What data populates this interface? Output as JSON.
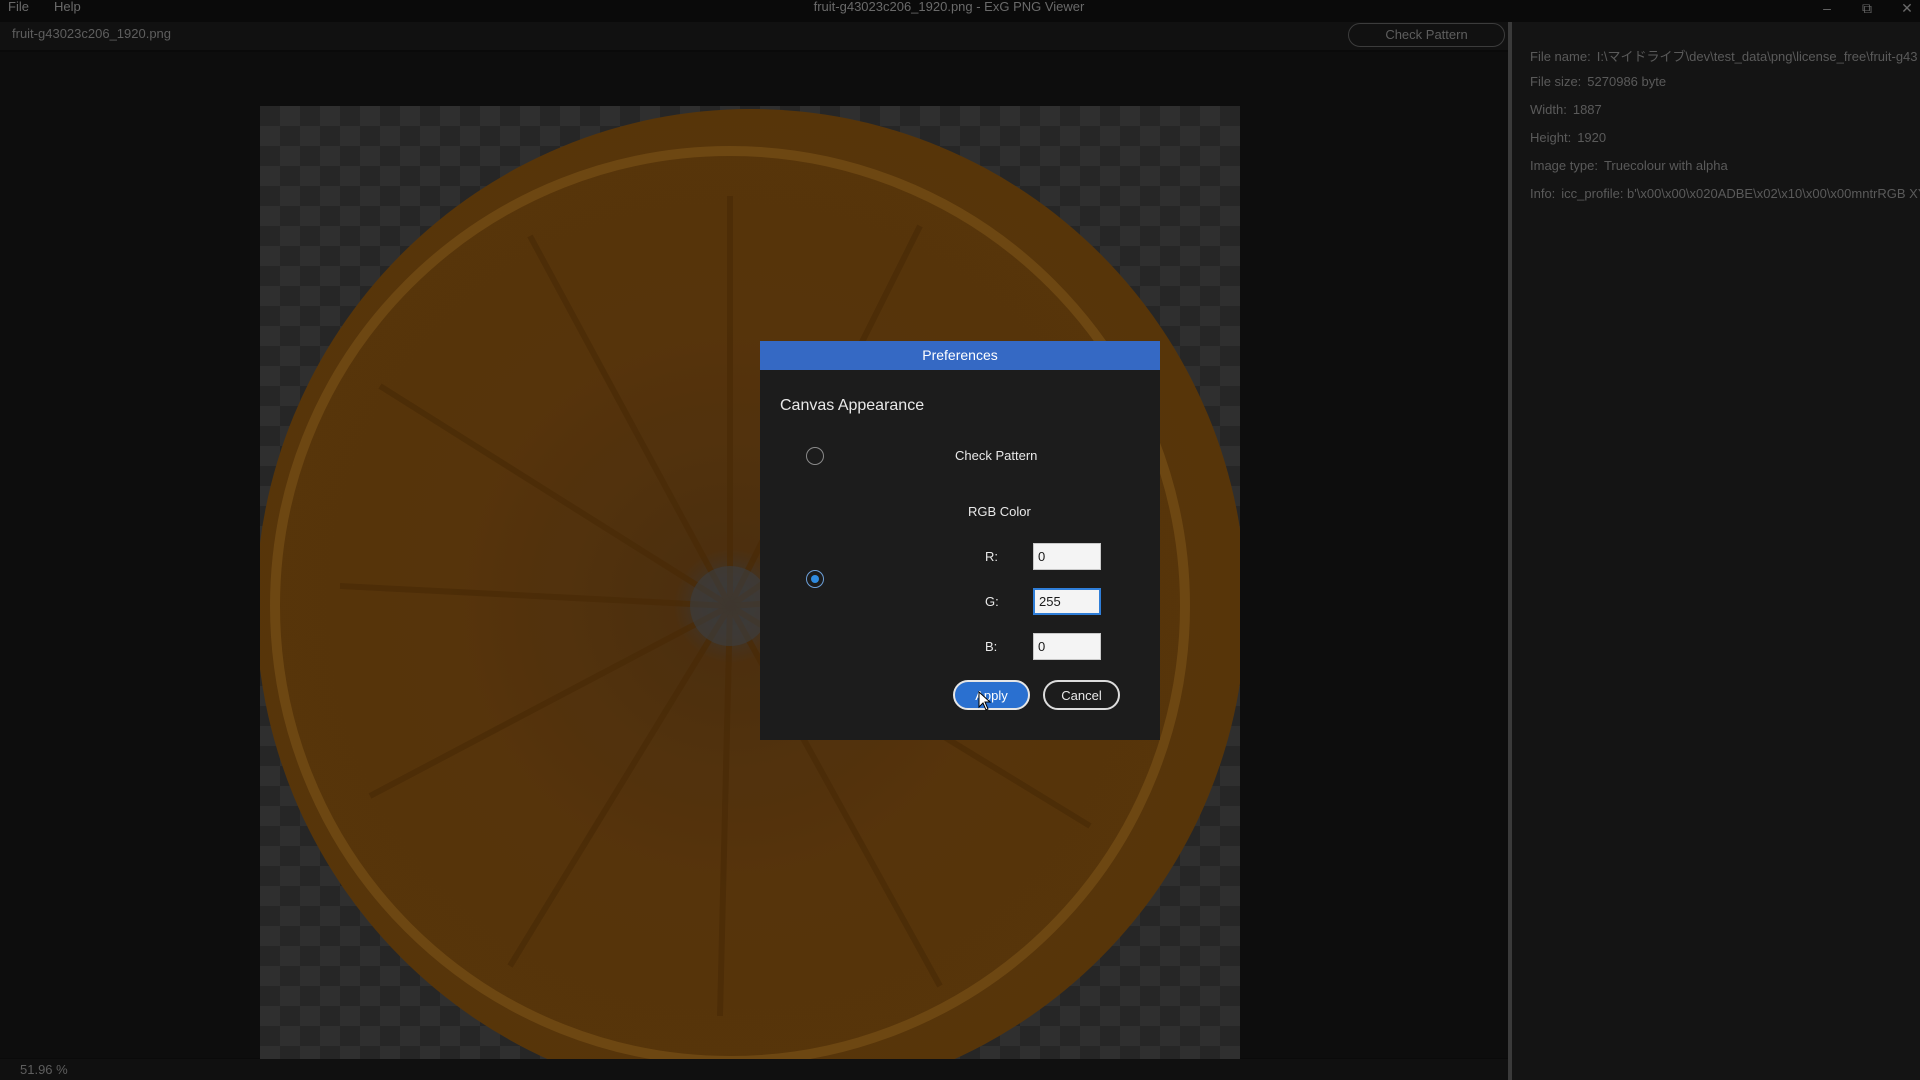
{
  "menu": {
    "file": "File",
    "help": "Help"
  },
  "window": {
    "title": "fruit-g43023c206_1920.png - ExG PNG Viewer",
    "minimize": "–",
    "maximize": "⧉",
    "close": "✕"
  },
  "toolbar": {
    "file_path": "fruit-g43023c206_1920.png",
    "check_pattern_button": "Check Pattern"
  },
  "status": {
    "zoom": "51.96 %"
  },
  "info": {
    "file_name_label": "File name:",
    "file_name": "I:\\マイドライブ\\dev\\test_data\\png\\license_free\\fruit-g43",
    "file_size_label": "File size:",
    "file_size": "5270986 byte",
    "width_label": "Width:",
    "width": "1887",
    "height_label": "Height:",
    "height": "1920",
    "image_type_label": "Image type:",
    "image_type": "Truecolour with alpha",
    "info_label": "Info:",
    "info_value": "icc_profile: b'\\x00\\x00\\x020ADBE\\x02\\x10\\x00\\x00mntrRGB XYZ"
  },
  "dialog": {
    "title": "Preferences",
    "section": "Canvas Appearance",
    "option_check_pattern": "Check Pattern",
    "option_rgb": "RGB Color",
    "selected_option": "RGB Color",
    "r_label": "R:",
    "r_value": "0",
    "g_label": "G:",
    "g_value": "255",
    "b_label": "B:",
    "b_value": "0",
    "apply": "Apply",
    "cancel": "Cancel"
  },
  "colors": {
    "accent": "#3569c4",
    "apply_button": "#2a70d0",
    "radio_selected": "#2f8be0"
  },
  "icons": [
    "minimize-icon",
    "maximize-icon",
    "close-icon",
    "mouse-cursor-icon"
  ]
}
